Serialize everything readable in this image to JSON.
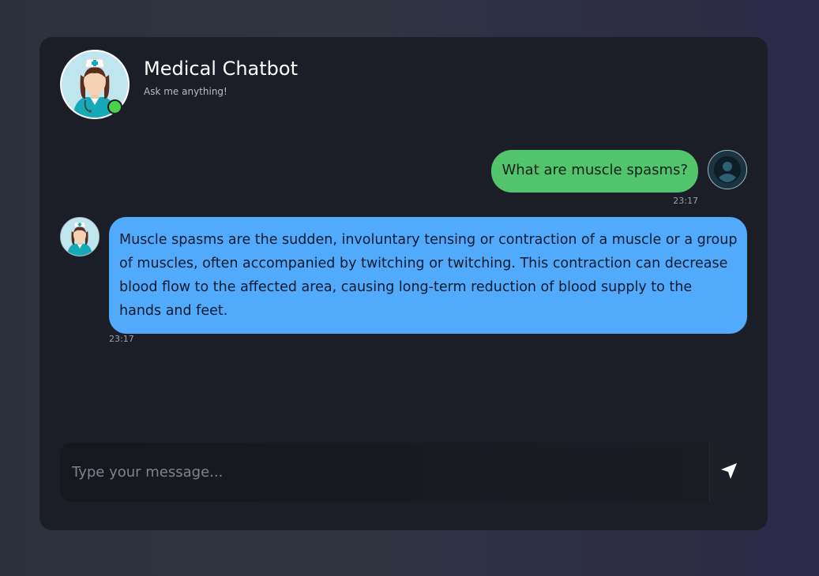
{
  "header": {
    "title": "Medical Chatbot",
    "subtitle": "Ask me anything!",
    "bot_avatar_icon": "nurse-avatar-icon",
    "status": "online"
  },
  "messages": [
    {
      "sender": "user",
      "text": "What are muscle spasms?",
      "time": "23:17",
      "avatar_icon": "user-avatar-icon"
    },
    {
      "sender": "bot",
      "text": "Muscle spasms are the sudden, involuntary tensing or contraction of a muscle or a group of muscles, often accompanied by twitching or twitching. This contraction can decrease blood flow to the affected area, causing long-term reduction of blood supply to the hands and feet.",
      "time": "23:17",
      "avatar_icon": "nurse-avatar-icon"
    }
  ],
  "composer": {
    "placeholder": "Type your message...",
    "value": "",
    "send_icon": "send-icon"
  },
  "colors": {
    "user_bubble": "#51c46c",
    "bot_bubble": "#52aafc",
    "online": "#4cd14a",
    "card": "#1b1e26"
  }
}
